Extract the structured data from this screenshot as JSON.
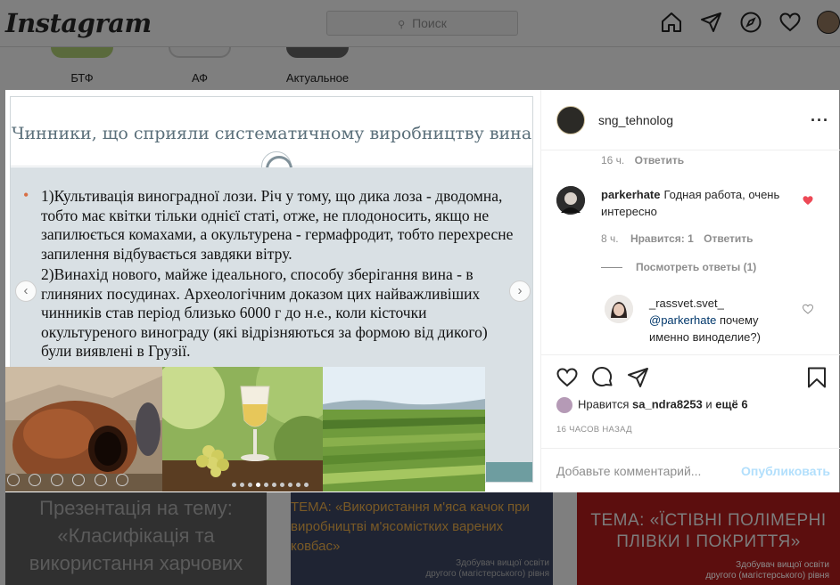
{
  "app": {
    "logo": "Instagram"
  },
  "header": {
    "search_placeholder": "Поиск"
  },
  "highlights": [
    {
      "label": "БТФ"
    },
    {
      "label": "АФ"
    },
    {
      "label": "Актуальное"
    }
  ],
  "slide": {
    "title": "Чинники, що сприяли систематичному виробництву вина",
    "paragraphs": [
      "1)Культивація виноградної лози. Річ у тому, що дика лоза - дводомна, тобто має квітки тільки однієї статі, отже, не плодоносить, якщо не запилюється комахами, а окультурена - гермафродит, тобто перехресне запилення відбувається завдяки вітру.",
      "2)Винахід нового, майже ідеального, способу зберігання вина - в глиняних посудинах. Археологічним доказом цих найважливіших чинників став період близько 6000 г до н.е., коли кісточки окультуреного винограду (які відрізняються за формою від дикого) були виявлені в Грузії."
    ],
    "carousel_dot_count": 10,
    "carousel_active_index": 3
  },
  "post": {
    "username": "sng_tehnolog",
    "comments": [
      {
        "meta_time": "16 ч.",
        "meta_reply": "Ответить"
      },
      {
        "username": "parkerhate",
        "text": "Годная работа, очень интересно",
        "meta_time": "8 ч.",
        "meta_likes": "Нравится: 1",
        "meta_reply": "Ответить",
        "liked": true
      }
    ],
    "view_replies": "Посмотреть ответы (1)",
    "reply": {
      "username": "_rassvet.svet_",
      "mention": "@parkerhate",
      "text": "почему именно виноделие?)"
    },
    "likes_prefix": "Нравится",
    "likes_user": "sa_ndra8253",
    "likes_and": "и",
    "likes_more": "ещё 6",
    "timestamp": "16 ЧАСОВ НАЗАД",
    "comment_placeholder": "Добавьте комментарий...",
    "publish_label": "Опубликовать"
  },
  "thumbnails": [
    {
      "text": "Презентація на тему: «Класифікація та використання харчових"
    },
    {
      "text": "ТЕМА: «Використання м'яса качок при виробництві м'ясомістких варених ковбас»",
      "sub1": "Здобувач вищої освіти",
      "sub2": "другого (магістерського) рівня"
    },
    {
      "text": "ТЕМА: «ЇСТІВНІ ПОЛІМЕРНІ ПЛІВКИ І ПОКРИТТЯ»",
      "sub1": "Здобувач вищої освіти",
      "sub2": "другого (магістерського) рівня"
    }
  ],
  "colors": {
    "heart_liked": "#ed4956",
    "link": "#00376b",
    "publish_disabled": "#b2dffc",
    "bullet": "#d86f44"
  }
}
